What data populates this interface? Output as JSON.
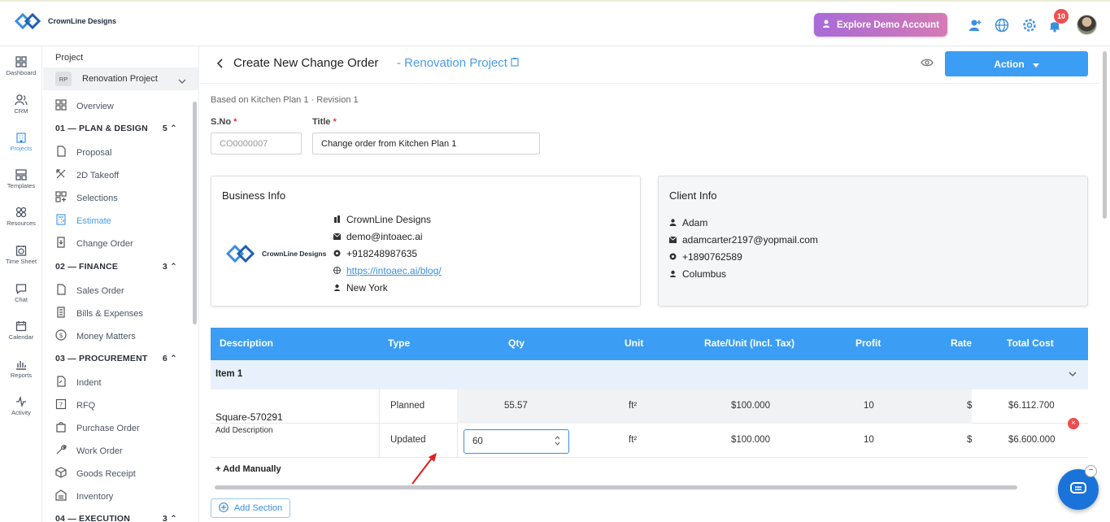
{
  "app": {
    "brand": "CrownLine Designs",
    "demo_button": "Explore Demo Account",
    "notification_count": "10"
  },
  "rail": [
    {
      "label": "Dashboard",
      "icon": "dashboard-icon"
    },
    {
      "label": "CRM",
      "icon": "users-icon"
    },
    {
      "label": "Projects",
      "icon": "building-icon",
      "active": true
    },
    {
      "label": "Templates",
      "icon": "templates-icon"
    },
    {
      "label": "Resources",
      "icon": "resources-icon"
    },
    {
      "label": "Time Sheet",
      "icon": "timesheet-icon"
    },
    {
      "label": "Chat",
      "icon": "chat-icon"
    },
    {
      "label": "Calendar",
      "icon": "calendar-icon"
    },
    {
      "label": "Reports",
      "icon": "reports-icon"
    },
    {
      "label": "Activity",
      "icon": "activity-icon"
    }
  ],
  "sidebar": {
    "title": "Project",
    "project_abbr": "RP",
    "project_name": "Renovation Project",
    "overview": "Overview",
    "sections": [
      {
        "label": "01 — PLAN & DESIGN",
        "count": "5",
        "items": [
          "Proposal",
          "2D Takeoff",
          "Selections",
          "Estimate",
          "Change Order"
        ]
      },
      {
        "label": "02 — FINANCE",
        "count": "3",
        "items": [
          "Sales Order",
          "Bills & Expenses",
          "Money Matters"
        ]
      },
      {
        "label": "03 — PROCUREMENT",
        "count": "6",
        "items": [
          "Indent",
          "RFQ",
          "Purchase Order",
          "Work Order",
          "Goods Receipt",
          "Inventory"
        ]
      },
      {
        "label": "04 — EXECUTION",
        "count": "3",
        "items": []
      }
    ],
    "active_item": "Estimate"
  },
  "header": {
    "title": "Create New Change Order",
    "dash": "-",
    "project": "Renovation Project",
    "action_label": "Action"
  },
  "form": {
    "based_on": "Based on Kitchen Plan 1 · Revision 1",
    "sno_label": "S.No",
    "sno_placeholder": "CO0000007",
    "title_label": "Title",
    "title_value": "Change order from Kitchen Plan 1"
  },
  "business": {
    "heading": "Business Info",
    "name": "CrownLine Designs",
    "email": "demo@intoaec.ai",
    "phone": "+918248987635",
    "website": "https://intoaec.ai/blog/",
    "city": "New York"
  },
  "client": {
    "heading": "Client Info",
    "name": "Adam",
    "email": "adamcarter2197@yopmail.com",
    "phone": "+1890762589",
    "city": "Columbus"
  },
  "table": {
    "headers": [
      "Description",
      "Type",
      "Qty",
      "Unit",
      "Rate/Unit (Incl. Tax)",
      "Profit",
      "Rate",
      "Total Cost"
    ],
    "group": "Item 1",
    "item_name": "Square-570291",
    "item_desc": "Add Description",
    "rows": [
      {
        "type": "Planned",
        "qty": "55.57",
        "unit": "ft²",
        "rate_unit": "$100.000",
        "profit": "10",
        "rate": "$",
        "total": "$6.112.700"
      },
      {
        "type": "Updated",
        "qty": "60",
        "unit": "ft²",
        "rate_unit": "$100.000",
        "profit": "10",
        "rate": "$",
        "total": "$6.600.000"
      }
    ],
    "add_manually": "+ Add Manually",
    "add_section": "Add Section"
  }
}
